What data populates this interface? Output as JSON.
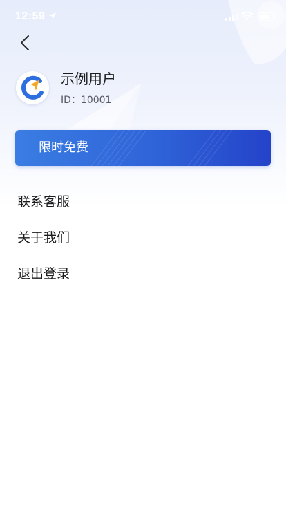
{
  "status_bar": {
    "time": "12:59",
    "icons": [
      "location-arrow-icon",
      "signal-icon",
      "wifi-icon",
      "battery-icon"
    ]
  },
  "header": {
    "back_icon": "chevron-left-icon"
  },
  "profile": {
    "name": "示例用户",
    "id_text": "ID：10001",
    "avatar_icon": "app-logo-icon"
  },
  "promo": {
    "label": "限时免费"
  },
  "menu": {
    "items": [
      {
        "label": "联系客服"
      },
      {
        "label": "关于我们"
      },
      {
        "label": "退出登录"
      }
    ]
  },
  "colors": {
    "accent": "#2f63d8",
    "banner_start": "#3a7de3",
    "banner_end": "#2443c9",
    "logo_blue": "#2e6fe0",
    "logo_orange": "#f5a623"
  }
}
